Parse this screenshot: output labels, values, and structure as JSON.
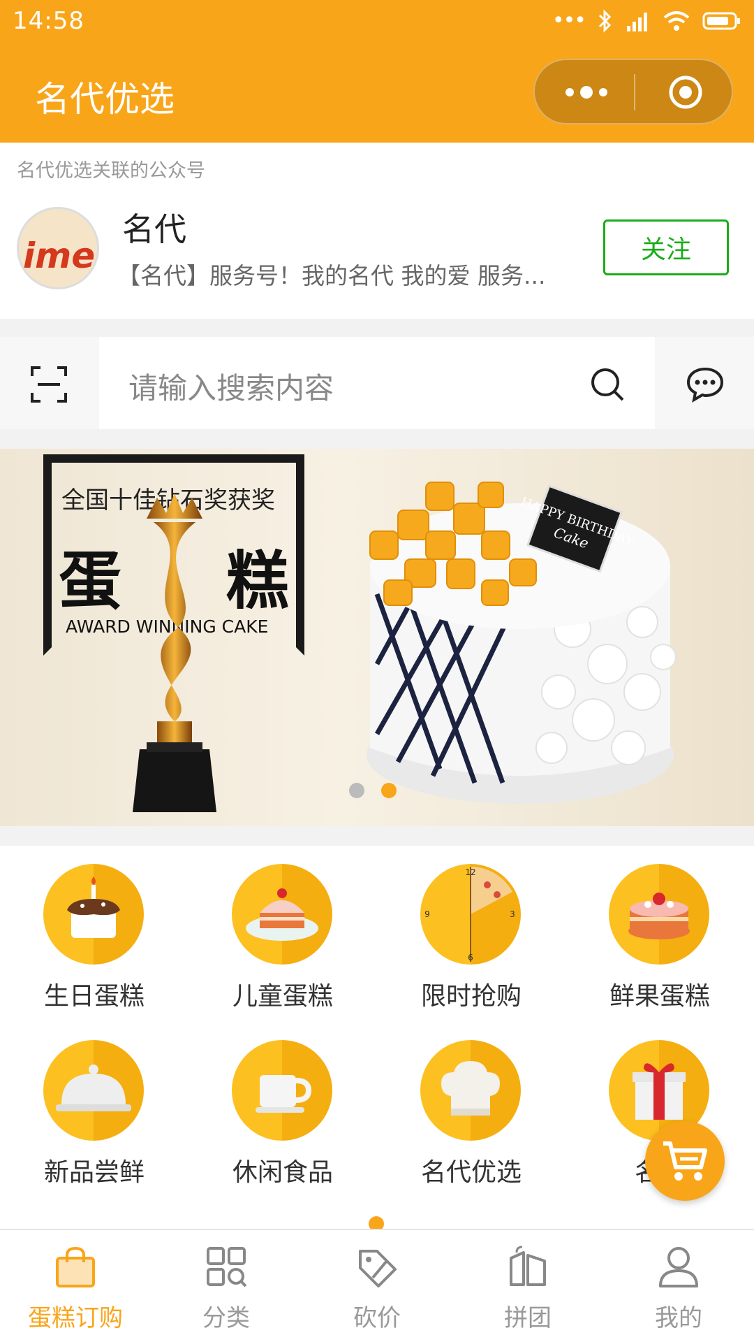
{
  "status_bar": {
    "time": "14:58"
  },
  "nav": {
    "title": "名代优选"
  },
  "official_account": {
    "hint": "名代优选关联的公众号",
    "logo_text": "ime",
    "name": "名代",
    "description": "【名代】服务号！我的名代 我的爱 服务...",
    "follow_label": "关注"
  },
  "search": {
    "placeholder": "请输入搜索内容"
  },
  "banner": {
    "headline": "全国十佳钻石奖获奖",
    "big_left": "蛋",
    "big_right": "糕",
    "english": "AWARD WINNING CAKE",
    "slide_count": 2,
    "active_slide": 2
  },
  "categories": [
    {
      "label": "生日蛋糕",
      "icon": "birthday-cake-icon"
    },
    {
      "label": "儿童蛋糕",
      "icon": "kids-cake-icon"
    },
    {
      "label": "限时抢购",
      "icon": "flash-sale-clock-icon"
    },
    {
      "label": "鲜果蛋糕",
      "icon": "fruit-cake-icon"
    },
    {
      "label": "新品尝鲜",
      "icon": "cloche-icon"
    },
    {
      "label": "休闲食品",
      "icon": "cup-icon"
    },
    {
      "label": "名代优选",
      "icon": "chef-hat-icon"
    },
    {
      "label": "名代",
      "icon": "gift-icon"
    }
  ],
  "tabs": [
    {
      "label": "蛋糕订购",
      "icon": "shopping-bag-icon",
      "active": true
    },
    {
      "label": "分类",
      "icon": "category-grid-icon",
      "active": false
    },
    {
      "label": "砍价",
      "icon": "price-tag-icon",
      "active": false
    },
    {
      "label": "拼团",
      "icon": "group-buy-icon",
      "active": false
    },
    {
      "label": "我的",
      "icon": "user-icon",
      "active": false
    }
  ],
  "colors": {
    "brand": "#f9a51a",
    "follow_green": "#1aad19"
  }
}
